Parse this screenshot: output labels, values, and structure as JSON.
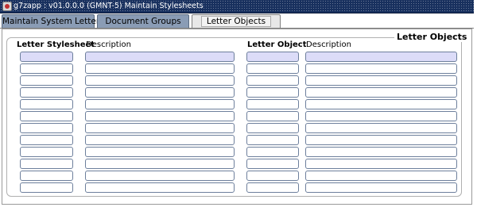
{
  "window": {
    "title": "g7zapp : v01.0.0.0 (GMNT-5) Maintain Stylesheets"
  },
  "tabs": [
    {
      "label": "Maintain System Letters",
      "active": false
    },
    {
      "label": "Document Groups",
      "active": false
    },
    {
      "label": "Letter Objects",
      "active": true
    }
  ],
  "group": {
    "title": "Letter Objects"
  },
  "stylesheets_block": {
    "header_stylesheet": "Letter Stylesheet",
    "header_description": "Description",
    "row_count": 12
  },
  "objects_block": {
    "header_object": "Letter Object",
    "header_description": "Description",
    "row_count": 12
  },
  "colors": {
    "titlebar": "#18305e",
    "tab_inactive": "#8a9cb5",
    "tab_active": "#e8e8e8",
    "current_record": "#dcdcf8",
    "field_border": "#6d7f9c"
  }
}
